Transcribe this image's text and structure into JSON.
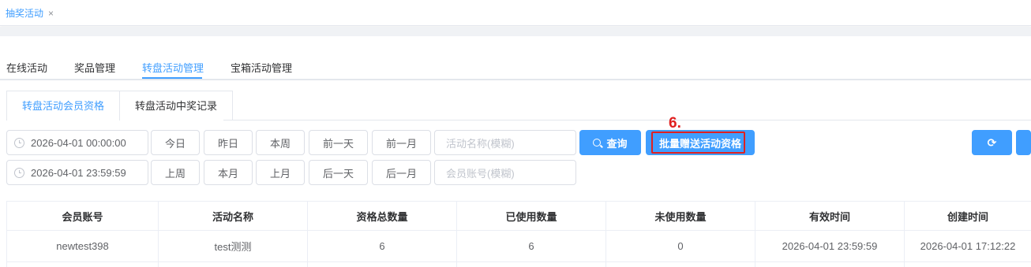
{
  "page_tab": {
    "label": "抽奖活动",
    "close": "×"
  },
  "subnav": [
    "在线活动",
    "奖品管理",
    "转盘活动管理",
    "宝箱活动管理"
  ],
  "card_tabs": [
    "转盘活动会员资格",
    "转盘活动中奖记录"
  ],
  "filters": {
    "start_time": "2026-04-01 00:00:00",
    "end_time": "2026-04-01 23:59:59",
    "quick_row1": [
      "今日",
      "昨日",
      "本周",
      "前一天",
      "前一月"
    ],
    "quick_row2": [
      "上周",
      "本月",
      "上月",
      "后一天",
      "后一月"
    ],
    "activity_name_placeholder": "活动名称(模糊)",
    "member_account_placeholder": "会员账号(模糊)"
  },
  "actions": {
    "query": "查询",
    "batch_grant": "批量赠送活动资格",
    "step_marker": "6."
  },
  "icons": {
    "clock": "clock-icon",
    "search": "search-icon",
    "refresh": "refresh-icon"
  },
  "colors": {
    "accent": "#409eff",
    "highlight": "#e02020"
  },
  "table": {
    "columns": [
      "会员账号",
      "活动名称",
      "资格总数量",
      "已使用数量",
      "未使用数量",
      "有效时间",
      "创建时间"
    ],
    "rows": [
      [
        "newtest398",
        "test测测",
        "6",
        "6",
        "0",
        "2026-04-01 23:59:59",
        "2026-04-01 17:12:22"
      ]
    ]
  }
}
